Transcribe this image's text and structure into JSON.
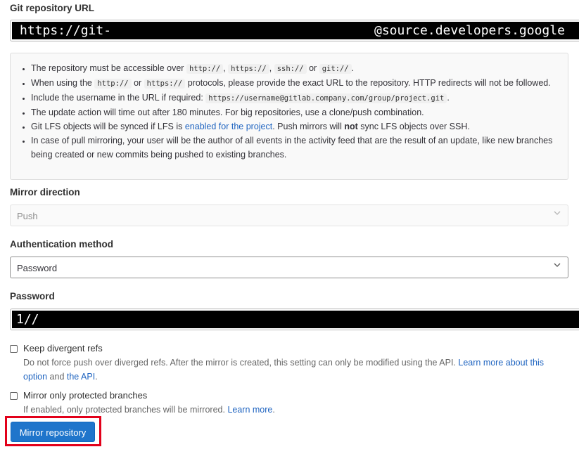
{
  "git_url": {
    "label": "Git repository URL",
    "value_prefix": "https://git-",
    "value_suffix": "@source.developers.google"
  },
  "help": {
    "item1": {
      "a": "The repository must be accessible over ",
      "c1": "http://",
      "s1": ", ",
      "c2": "https://",
      "s2": ", ",
      "c3": "ssh://",
      "s3": " or ",
      "c4": "git://",
      "s4": "."
    },
    "item2": {
      "a": "When using the ",
      "c1": "http://",
      "s1": " or ",
      "c2": "https://",
      "b": " protocols, please provide the exact URL to the repository. HTTP redirects will not be followed."
    },
    "item3": {
      "a": "Include the username in the URL if required: ",
      "c1": "https://username@gitlab.company.com/group/project.git",
      "b": "."
    },
    "item4": "The update action will time out after 180 minutes. For big repositories, use a clone/push combination.",
    "item5": {
      "a": "Git LFS objects will be synced if LFS is ",
      "link": "enabled for the project",
      "b": ". Push mirrors will ",
      "strong": "not",
      "c": " sync LFS objects over SSH."
    },
    "item6": "In case of pull mirroring, your user will be the author of all events in the activity feed that are the result of an update, like new branches being created or new commits being pushed to existing branches."
  },
  "mirror_direction": {
    "label": "Mirror direction",
    "value": "Push"
  },
  "auth_method": {
    "label": "Authentication method",
    "value": "Password"
  },
  "password": {
    "label": "Password",
    "value_prefix": "1//"
  },
  "keep_divergent": {
    "label": "Keep divergent refs",
    "help_a": "Do not force push over diverged refs. After the mirror is created, this setting can only be modified using the API. ",
    "help_link1": "Learn more about this option",
    "help_b": " and ",
    "help_link2": "the API",
    "help_c": "."
  },
  "protected_only": {
    "label": "Mirror only protected branches",
    "help_a": "If enabled, only protected branches will be mirrored. ",
    "help_link": "Learn more",
    "help_b": "."
  },
  "submit": {
    "label": "Mirror repository"
  },
  "icons": {
    "chevron": "chevron-down-icon"
  },
  "colors": {
    "accent": "#1f75cb",
    "link": "#1f64c0",
    "highlight": "#e2001a"
  }
}
